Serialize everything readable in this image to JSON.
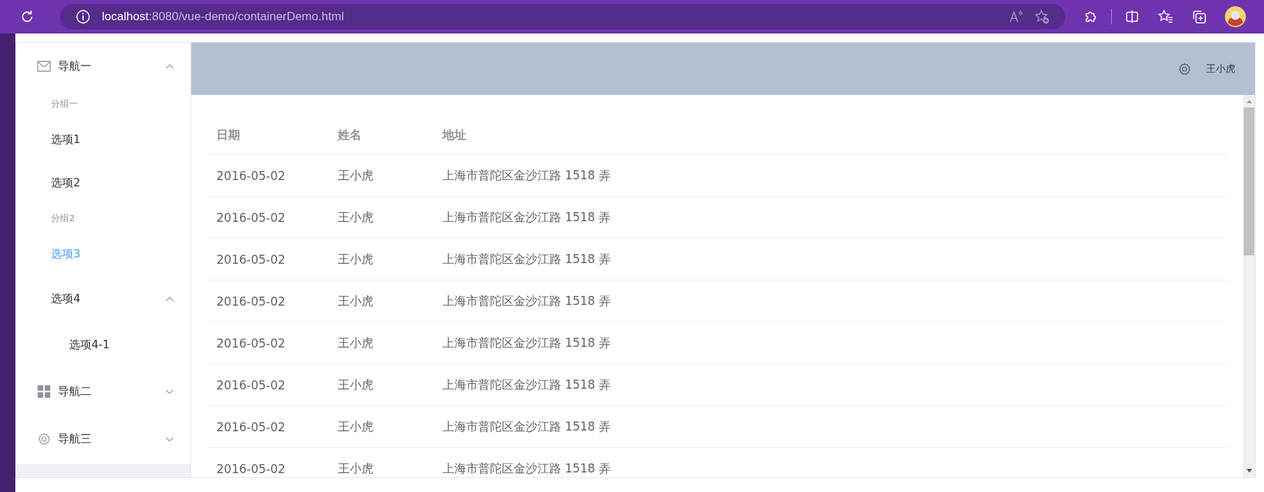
{
  "browser": {
    "url_host": "localhost",
    "url_rest": ":8080/vue-demo/containerDemo.html"
  },
  "sidebar": {
    "menus": [
      {
        "label": "导航一",
        "expanded": true,
        "groups": [
          {
            "title": "分组一",
            "items": [
              {
                "kind": "item",
                "label": "选项1",
                "selected": false
              },
              {
                "kind": "item",
                "label": "选项2",
                "selected": false
              }
            ]
          },
          {
            "title": "分组2",
            "items": [
              {
                "kind": "item",
                "label": "选项3",
                "selected": true
              },
              {
                "kind": "submenu",
                "label": "选项4",
                "expanded": true,
                "children": [
                  {
                    "label": "选项4-1",
                    "selected": false
                  }
                ]
              }
            ]
          }
        ]
      },
      {
        "label": "导航二",
        "expanded": false
      },
      {
        "label": "导航三",
        "expanded": false
      }
    ]
  },
  "header": {
    "user": "王小虎"
  },
  "table": {
    "columns": [
      "日期",
      "姓名",
      "地址"
    ],
    "rows": [
      [
        "2016-05-02",
        "王小虎",
        "上海市普陀区金沙江路 1518 弄"
      ],
      [
        "2016-05-02",
        "王小虎",
        "上海市普陀区金沙江路 1518 弄"
      ],
      [
        "2016-05-02",
        "王小虎",
        "上海市普陀区金沙江路 1518 弄"
      ],
      [
        "2016-05-02",
        "王小虎",
        "上海市普陀区金沙江路 1518 弄"
      ],
      [
        "2016-05-02",
        "王小虎",
        "上海市普陀区金沙江路 1518 弄"
      ],
      [
        "2016-05-02",
        "王小虎",
        "上海市普陀区金沙江路 1518 弄"
      ],
      [
        "2016-05-02",
        "王小虎",
        "上海市普陀区金沙江路 1518 弄"
      ],
      [
        "2016-05-02",
        "王小虎",
        "上海市普陀区金沙江路 1518 弄"
      ]
    ]
  }
}
